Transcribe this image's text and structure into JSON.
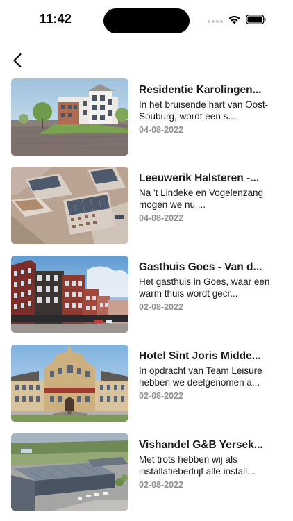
{
  "status_bar": {
    "time": "11:42"
  },
  "icons": {
    "back": "chevron-left-icon",
    "wifi": "wifi-icon",
    "battery": "battery-icon",
    "signal": "signal-icon"
  },
  "news": [
    {
      "title": "Residentie Karolingen...",
      "description": "In het bruisende hart van Oost-Souburg, wordt een s...",
      "date": "04-08-2022"
    },
    {
      "title": "Leeuwerik Halsteren -...",
      "description": "Na 't Lindeke en Vogelenzang mogen we nu ...",
      "date": "04-08-2022"
    },
    {
      "title": "Gasthuis Goes - Van d...",
      "description": "Het gasthuis in Goes, waar een warm thuis wordt gecr...",
      "date": "02-08-2022"
    },
    {
      "title": "Hotel Sint Joris Midde...",
      "description": "In opdracht van Team Leisure hebben we deelgenomen a...",
      "date": "02-08-2022"
    },
    {
      "title": "Vishandel G&B Yersek...",
      "description": "Met trots hebben wij als installatiebedrijf alle install...",
      "date": "02-08-2022"
    }
  ]
}
